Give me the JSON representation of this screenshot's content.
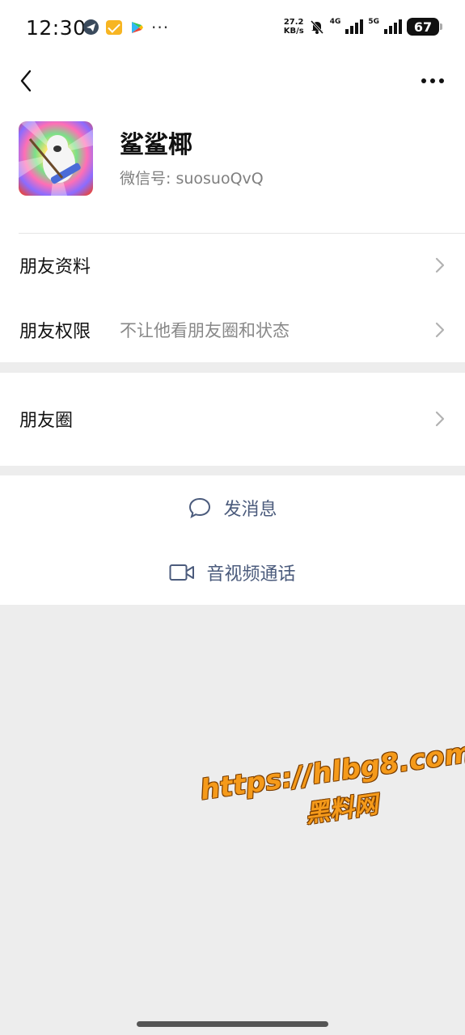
{
  "status_bar": {
    "time": "12:30",
    "net_speed_value": "27.2",
    "net_speed_unit": "KB/s",
    "signal1_label": "4G",
    "signal2_label": "5G",
    "battery": "67",
    "icons": [
      "telegram-icon",
      "mail-icon",
      "play-store-icon",
      "more-dots-icon",
      "mute-bell-icon"
    ]
  },
  "nav": {
    "back_icon": "chevron-left-icon",
    "more_icon": "more-horizontal-icon"
  },
  "profile": {
    "name": "鲨鲨椰",
    "wechat_id": "微信号:  suosuoQvQ"
  },
  "rows": [
    {
      "label": "朋友资料",
      "value": ""
    },
    {
      "label": "朋友权限",
      "value": "不让他看朋友圈和状态"
    },
    {
      "label": "朋友圈",
      "value": ""
    }
  ],
  "actions": {
    "message": "发消息",
    "video_call": "音视频通话"
  },
  "watermark": {
    "url": "https://hlbg8.com",
    "text": "黑料网"
  },
  "colors": {
    "background": "#ededed",
    "action_text": "#4b5b7c",
    "secondary_text": "#888888"
  }
}
